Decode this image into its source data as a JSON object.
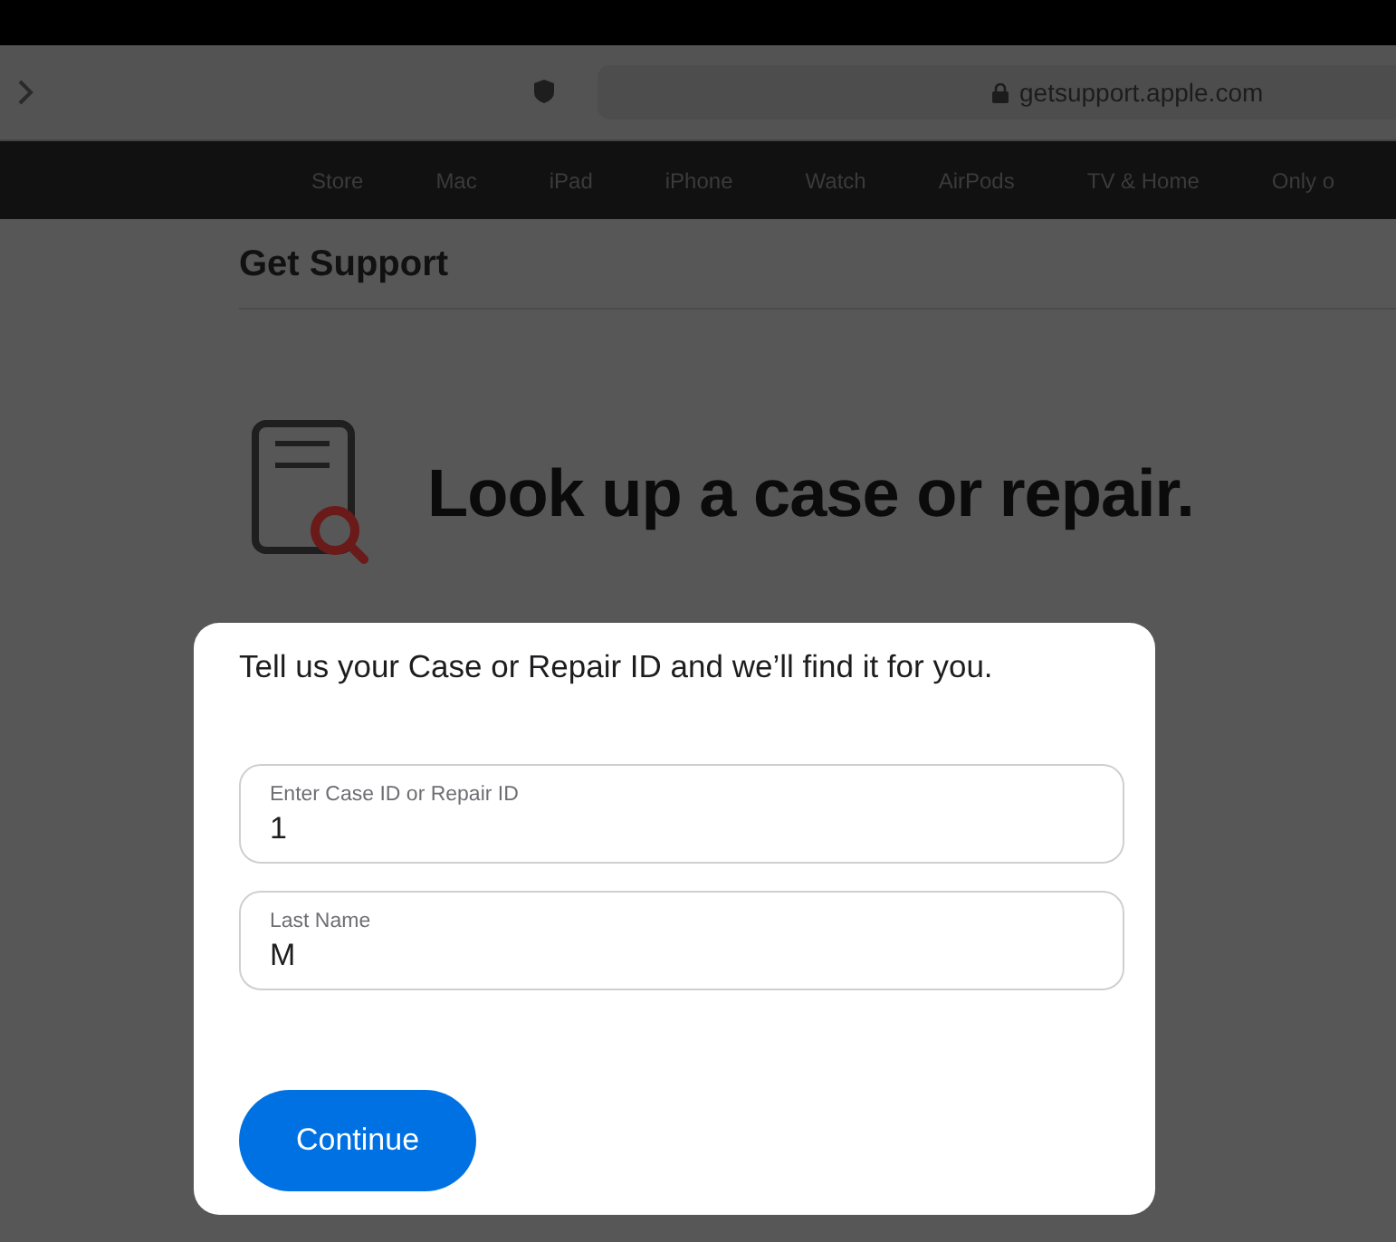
{
  "browser": {
    "address": "getsupport.apple.com"
  },
  "nav": {
    "items": [
      "Store",
      "Mac",
      "iPad",
      "iPhone",
      "Watch",
      "AirPods",
      "TV & Home",
      "Only o"
    ]
  },
  "page": {
    "title": "Get Support",
    "heading": "Look up a case or repair."
  },
  "dialog": {
    "prompt": "Tell us your Case or Repair ID and we’ll find it for you.",
    "fields": [
      {
        "label": "Enter Case ID or Repair ID",
        "value": "1"
      },
      {
        "label": "Last Name",
        "value": "M"
      }
    ],
    "button": "Continue"
  }
}
